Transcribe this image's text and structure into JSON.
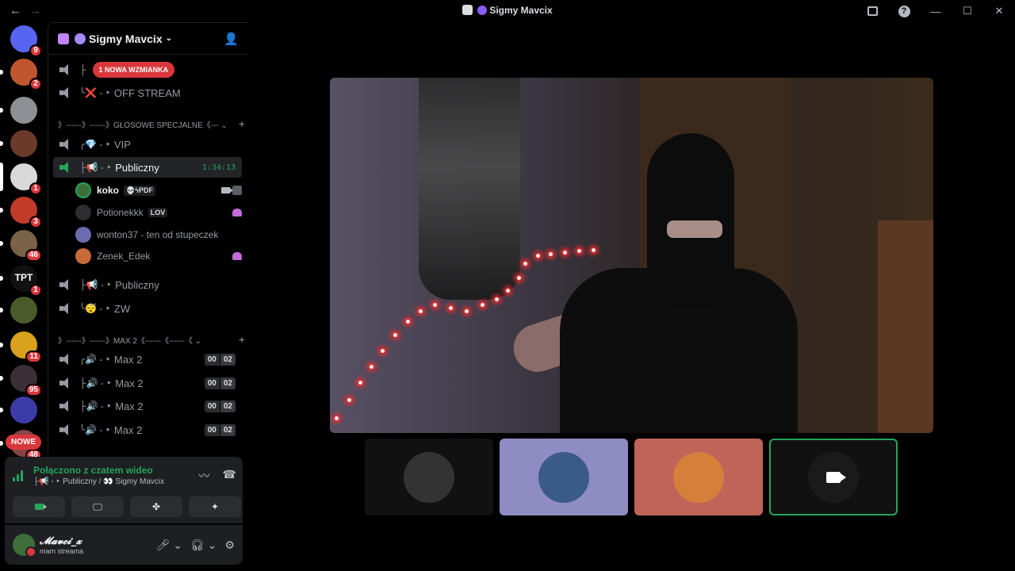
{
  "window": {
    "title": "Sigmy Mavcix"
  },
  "colors": {
    "accent_green": "#23a55a",
    "badge_red": "#da373c",
    "panel": "#1e1f22",
    "background": "#000000"
  },
  "servers": [
    {
      "name": "discord-home",
      "badge": "9",
      "color": "#5865f2"
    },
    {
      "name": "server-2",
      "badge": "2",
      "color": "#c0562f"
    },
    {
      "name": "server-3",
      "badge": "",
      "color": "#8d8f95"
    },
    {
      "name": "server-4",
      "badge": "",
      "color": "#6b3a2a"
    },
    {
      "name": "server-5",
      "badge": "1",
      "color": "#d9d9d9"
    },
    {
      "name": "server-6",
      "badge": "3",
      "color": "#c23a2a"
    },
    {
      "name": "server-7",
      "badge": "46",
      "color": "#7a6248"
    },
    {
      "name": "server-tpt",
      "badge": "1",
      "color": "#111111",
      "label": "TPT"
    },
    {
      "name": "server-9",
      "badge": "",
      "color": "#4a5a2a"
    },
    {
      "name": "server-10",
      "badge": "11",
      "color": "#d8a21e"
    },
    {
      "name": "server-11",
      "badge": "95",
      "color": "#3a2f34"
    },
    {
      "name": "server-12",
      "badge": "",
      "color": "#3c3ca8"
    },
    {
      "name": "server-13",
      "badge": "48",
      "color": "#884444"
    }
  ],
  "servers_new_label": "NOWE",
  "guild": {
    "name": "Sigmy Mavcix"
  },
  "channels": {
    "top": [
      {
        "name": "",
        "prefix": "├",
        "mention": "1 NOWA WZMIANKA"
      },
      {
        "name": "OFF STREAM",
        "prefix": "╰❌ - ‣"
      }
    ],
    "category1": "》------》------》GŁOSOWE SPECJALNE《--- ⌄",
    "cat1_channels": [
      {
        "name": "VIP",
        "prefix": "╭💎 - ‣"
      },
      {
        "name": "Publiczny",
        "prefix": "├📢 - ‣",
        "timer": "1:34:13"
      }
    ],
    "users": [
      {
        "name": "koko",
        "tag": "💀ϟPDF",
        "live": true
      },
      {
        "name": "Potionekkk",
        "tag": "LOV"
      },
      {
        "name": "wonton37 - ten od stupeczek",
        "tag": ""
      },
      {
        "name": "Zenek_Edek",
        "tag": ""
      }
    ],
    "cat1_after": [
      {
        "name": "Publiczny",
        "prefix": "├📢 - ‣"
      },
      {
        "name": "ZW",
        "prefix": "╰😴 - ‣"
      }
    ],
    "category2": "》------》------》MAX 2《------《------《 ⌄",
    "cat2_channels": [
      {
        "name": "Max 2",
        "prefix": "╭🔊 - ‣",
        "count": "00",
        "limit": "02"
      },
      {
        "name": "Max 2",
        "prefix": "├🔊 - ‣",
        "count": "00",
        "limit": "02"
      },
      {
        "name": "Max 2",
        "prefix": "├🔊 - ‣",
        "count": "00",
        "limit": "02"
      },
      {
        "name": "Max 2",
        "prefix": "╰🔊 - ‣",
        "count": "00",
        "limit": "02"
      }
    ]
  },
  "voice": {
    "status": "Połączono z czatem wideo",
    "location": "├📢 - ‣ Publiczny / 👀 Sigmy Mavcix"
  },
  "user": {
    "name": "𝓜𝓪𝓿𝓬𝓲_𝔁",
    "status": "mam streama"
  },
  "tiles": [
    {
      "name": "tile-koko",
      "color": "#111111",
      "avatar": "#333333"
    },
    {
      "name": "tile-wonton",
      "color": "#8e8cc2",
      "avatar": "#3a5a8a"
    },
    {
      "name": "tile-zenek",
      "color": "#c0645a",
      "avatar": "#d4803a"
    },
    {
      "name": "tile-self",
      "color": "#111111",
      "avatar": "#222222"
    }
  ]
}
